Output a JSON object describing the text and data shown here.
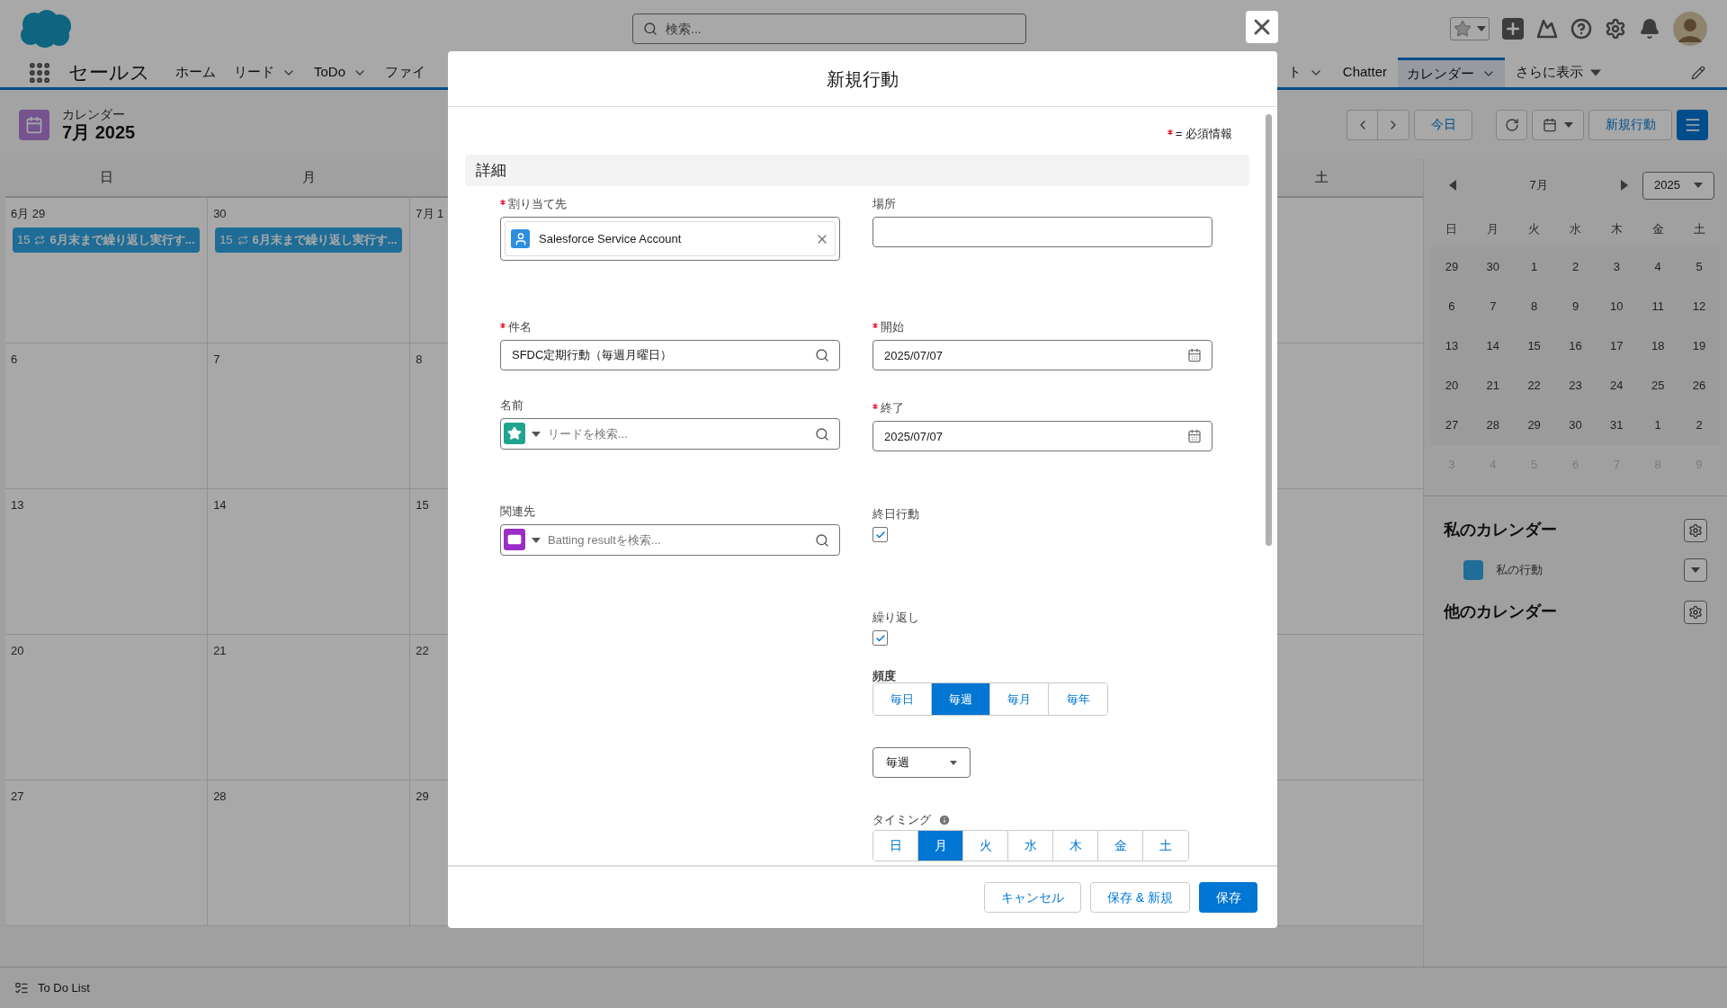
{
  "header": {
    "search_placeholder": "検索...",
    "app_name": "セールス",
    "nav_tabs_left": [
      {
        "label": "ホーム",
        "kind": "plain",
        "selected": false
      },
      {
        "label": "リード",
        "kind": "chevron",
        "selected": false
      },
      {
        "label": "ToDo",
        "kind": "chevron",
        "selected": false
      },
      {
        "label": "ファイ",
        "kind": "plain",
        "selected": false
      }
    ],
    "nav_tabs_right": [
      {
        "label": "ト",
        "kind": "chevron",
        "selected": false
      },
      {
        "label": "Chatter",
        "kind": "plain",
        "selected": false
      },
      {
        "label": "カレンダー",
        "kind": "chevron",
        "selected": true
      },
      {
        "label": "さらに表示",
        "kind": "triangle",
        "selected": false
      }
    ]
  },
  "page_header": {
    "object_label": "カレンダー",
    "title": "7月 2025",
    "today_button": "今日",
    "new_button": "新規行動"
  },
  "calendar": {
    "columns": [
      {
        "header": "日",
        "dates": [
          {
            "label": "6月 29",
            "events": [
              {
                "time": "15",
                "title": "6月末まで繰り返し実行す..."
              }
            ]
          },
          {
            "label": "6"
          },
          {
            "label": "13"
          },
          {
            "label": "20"
          },
          {
            "label": "27"
          }
        ]
      },
      {
        "header": "月",
        "dates": [
          {
            "label": "30",
            "events": [
              {
                "time": "15",
                "title": "6月末まで繰り返し実行す..."
              }
            ]
          },
          {
            "label": "7"
          },
          {
            "label": "14"
          },
          {
            "label": "21"
          },
          {
            "label": "28"
          }
        ]
      },
      {
        "dates": [
          {
            "label": "7月 1"
          },
          {
            "label": "8"
          },
          {
            "label": "15"
          },
          {
            "label": "22"
          },
          {
            "label": "29"
          }
        ]
      }
    ],
    "last_column": {
      "header": "土"
    }
  },
  "mini_calendar": {
    "month": "7月",
    "year": "2025",
    "weekdays": [
      "日",
      "月",
      "火",
      "水",
      "木",
      "金",
      "土"
    ],
    "weeks": [
      {
        "faded": false,
        "days": [
          "29",
          "30",
          "1",
          "2",
          "3",
          "4",
          "5"
        ]
      },
      {
        "faded": false,
        "days": [
          "6",
          "7",
          "8",
          "9",
          "10",
          "11",
          "12"
        ]
      },
      {
        "faded": false,
        "days": [
          "13",
          "14",
          "15",
          "16",
          "17",
          "18",
          "19"
        ]
      },
      {
        "faded": false,
        "days": [
          "20",
          "21",
          "22",
          "23",
          "24",
          "25",
          "26"
        ]
      },
      {
        "faded": false,
        "days": [
          "27",
          "28",
          "29",
          "30",
          "31",
          "1",
          "2"
        ]
      },
      {
        "faded": true,
        "days": [
          "3",
          "4",
          "5",
          "6",
          "7",
          "8",
          "9"
        ]
      }
    ]
  },
  "my_calendars": {
    "title": "私のカレンダー",
    "items": [
      {
        "label": "私の行動",
        "color": "#1f6e98"
      }
    ]
  },
  "other_calendars": {
    "title": "他のカレンダー"
  },
  "bottom_bar": {
    "label": "To Do List"
  },
  "modal": {
    "title": "新規行動",
    "required_note": "= 必須情報",
    "section": "詳細",
    "assigned_to": {
      "label": "割り当て先",
      "required": true,
      "value": "Salesforce Service Account"
    },
    "location": {
      "label": "場所",
      "required": false
    },
    "subject": {
      "label": "件名",
      "required": true,
      "value": "SFDC定期行動（毎週月曜日）"
    },
    "start": {
      "label": "開始",
      "required": true,
      "value": "2025/07/07"
    },
    "name": {
      "label": "名前",
      "required": false,
      "placeholder": "リードを検索..."
    },
    "end": {
      "label": "終了",
      "required": true,
      "value": "2025/07/07"
    },
    "related": {
      "label": "関連先",
      "required": false,
      "placeholder": "Batting resultを検索..."
    },
    "all_day": {
      "label": "終日行動",
      "checked": true
    },
    "recurrence": {
      "label": "繰り返し",
      "checked": true
    },
    "frequency": {
      "label": "頻度",
      "options": [
        {
          "label": "毎日",
          "selected": false
        },
        {
          "label": "毎週",
          "selected": true
        },
        {
          "label": "毎月",
          "selected": false
        },
        {
          "label": "毎年",
          "selected": false
        }
      ]
    },
    "interval_select": {
      "value": "毎週"
    },
    "timing": {
      "label": "タイミング",
      "days": [
        {
          "label": "日",
          "selected": false
        },
        {
          "label": "月",
          "selected": true
        },
        {
          "label": "火",
          "selected": false
        },
        {
          "label": "水",
          "selected": false
        },
        {
          "label": "木",
          "selected": false
        },
        {
          "label": "金",
          "selected": false
        },
        {
          "label": "土",
          "selected": false
        }
      ]
    },
    "buttons": {
      "cancel": "キャンセル",
      "save_new": "保存 & 新規",
      "save": "保存"
    }
  }
}
